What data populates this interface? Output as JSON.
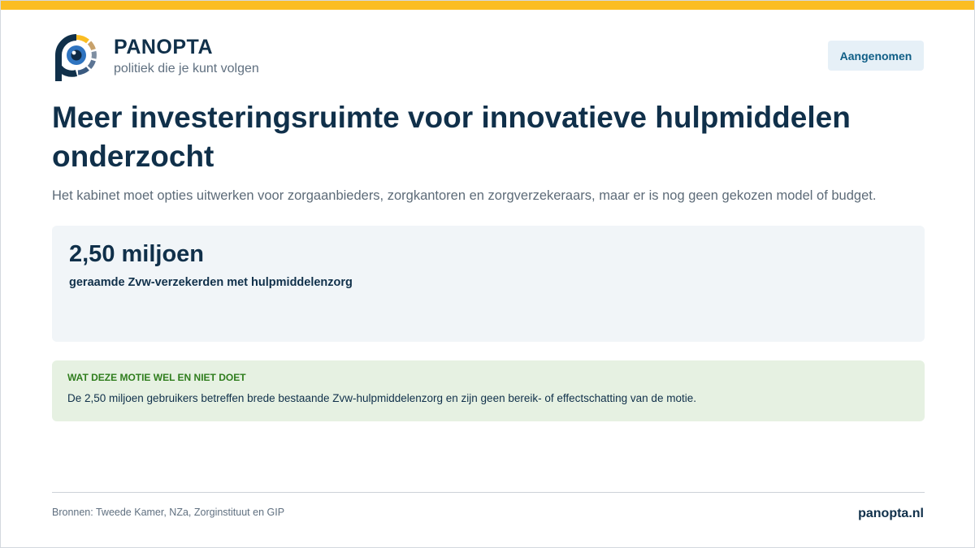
{
  "brand": {
    "name": "PANOPTA",
    "tagline": "politiek die je kunt volgen",
    "logo_icon": "panopta-eye-logo-icon",
    "accent_color": "#fbbd22",
    "primary_color": "#10304a"
  },
  "status": {
    "label": "Aangenomen"
  },
  "headline": {
    "title": "Meer investeringsruimte voor innovatieve hulpmiddelen onderzocht",
    "subtitle": "Het kabinet moet opties uitwerken voor zorgaanbieders, zorgkantoren en zorgverzekeraars, maar er is nog geen gekozen model of budget."
  },
  "stat": {
    "value": "2,50 miljoen",
    "label": "geraamde Zvw-verzekerden met hulpmiddelenzorg"
  },
  "note": {
    "heading": "WAT DEZE MOTIE WEL EN NIET DOET",
    "text": "De 2,50 miljoen gebruikers betreffen brede bestaande Zvw-hulpmiddelenzorg en zijn geen bereik- of effectschatting van de motie."
  },
  "footer": {
    "sources": "Bronnen: Tweede Kamer, NZa, Zorginstituut en GIP",
    "site": "panopta.nl"
  }
}
